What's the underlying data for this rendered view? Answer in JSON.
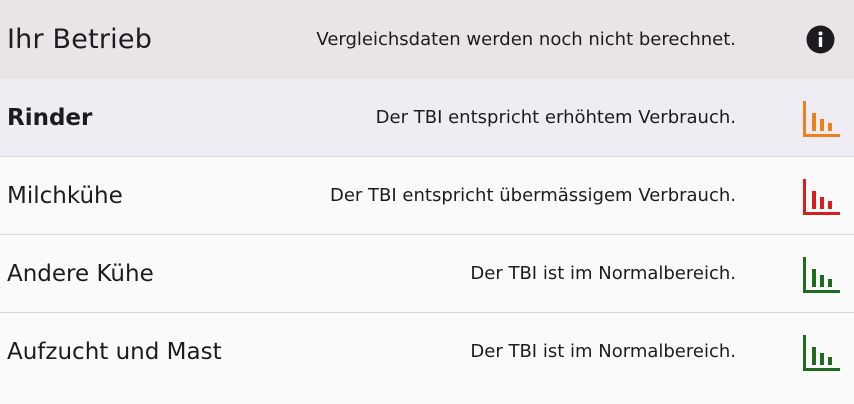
{
  "header": {
    "title": "Ihr Betrieb",
    "message": "Vergleichsdaten werden noch nicht berechnet.",
    "info_icon": "info-icon"
  },
  "colors": {
    "orange": "#ee7f1a",
    "red": "#d61f1f",
    "green": "#1f6b1f"
  },
  "rows": [
    {
      "name": "Rinder",
      "status": "Der TBI entspricht erhöhtem Verbrauch.",
      "icon": "bar-chart-icon",
      "color": "#ee7f1a",
      "selected": true
    },
    {
      "name": "Milchkühe",
      "status": "Der TBI entspricht übermässigem Verbrauch.",
      "icon": "bar-chart-icon",
      "color": "#d61f1f",
      "selected": false
    },
    {
      "name": "Andere Kühe",
      "status": "Der TBI ist im Normalbereich.",
      "icon": "bar-chart-icon",
      "color": "#1f6b1f",
      "selected": false
    },
    {
      "name": "Aufzucht und Mast",
      "status": "Der TBI ist im Normalbereich.",
      "icon": "bar-chart-icon",
      "color": "#1f6b1f",
      "selected": false
    }
  ]
}
